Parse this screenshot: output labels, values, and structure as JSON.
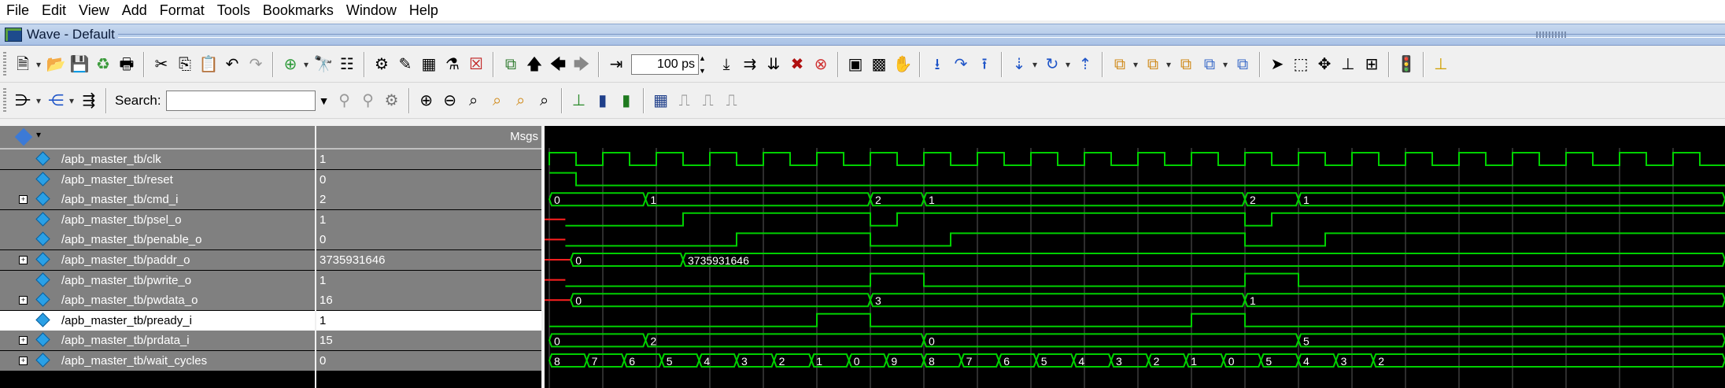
{
  "menubar": [
    "File",
    "Edit",
    "View",
    "Add",
    "Format",
    "Tools",
    "Bookmarks",
    "Window",
    "Help"
  ],
  "title": "Wave - Default",
  "toolbar": {
    "time_value": "100 ps",
    "search_label": "Search:",
    "search_value": ""
  },
  "panes": {
    "value_header": "Msgs"
  },
  "signals": [
    {
      "name": "/apb_master_tb/clk",
      "value": "1",
      "expandable": false,
      "selected": false
    },
    {
      "name": "/apb_master_tb/reset",
      "value": "0",
      "expandable": false,
      "selected": false
    },
    {
      "name": "/apb_master_tb/cmd_i",
      "value": "2",
      "expandable": true,
      "selected": false
    },
    {
      "name": "/apb_master_tb/psel_o",
      "value": "1",
      "expandable": false,
      "selected": false
    },
    {
      "name": "/apb_master_tb/penable_o",
      "value": "0",
      "expandable": false,
      "selected": false
    },
    {
      "name": "/apb_master_tb/paddr_o",
      "value": "3735931646",
      "expandable": true,
      "selected": false
    },
    {
      "name": "/apb_master_tb/pwrite_o",
      "value": "1",
      "expandable": false,
      "selected": false
    },
    {
      "name": "/apb_master_tb/pwdata_o",
      "value": "16",
      "expandable": true,
      "selected": false
    },
    {
      "name": "/apb_master_tb/pready_i",
      "value": "1",
      "expandable": false,
      "selected": true
    },
    {
      "name": "/apb_master_tb/prdata_i",
      "value": "15",
      "expandable": true,
      "selected": false
    },
    {
      "name": "/apb_master_tb/wait_cycles",
      "value": "0",
      "expandable": true,
      "selected": false
    }
  ],
  "waves": {
    "bus_labels": {
      "cmd_i": [
        "0",
        "1",
        "2",
        "1",
        "2",
        "1"
      ],
      "paddr_o": [
        "0",
        "3735931646"
      ],
      "pwdata_o": [
        "0",
        "3",
        "1"
      ],
      "prdata_i": [
        "0",
        "2",
        "0",
        "5"
      ],
      "wait_cycles": [
        "8",
        "7",
        "6",
        "5",
        "4",
        "3",
        "2",
        "1",
        "0",
        "9",
        "8",
        "7",
        "6",
        "5",
        "4",
        "3",
        "2",
        "1",
        "0",
        "5",
        "4",
        "3",
        "2"
      ]
    }
  },
  "colors": {
    "wave": "#00d000",
    "unknown": "#ff2020",
    "grid": "#5a5a5a",
    "background": "#000000"
  }
}
